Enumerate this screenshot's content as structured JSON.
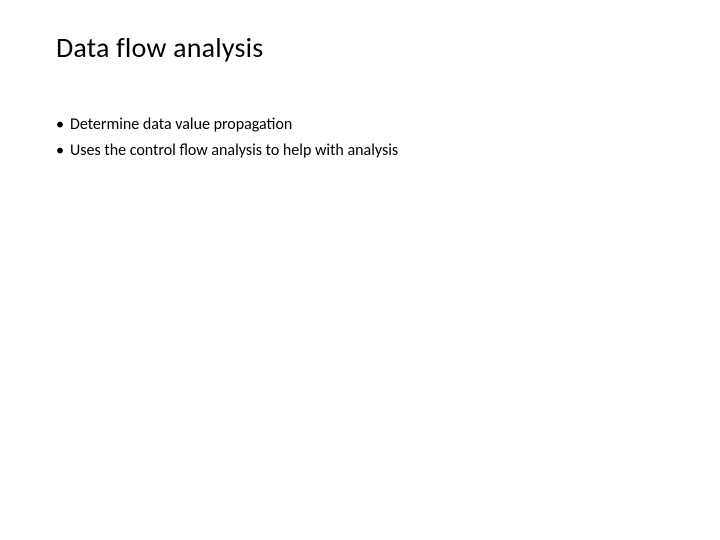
{
  "slide": {
    "title": "Data flow analysis",
    "bullets": [
      "Determine data value propagation",
      "Uses the control flow analysis to help with analysis"
    ]
  }
}
